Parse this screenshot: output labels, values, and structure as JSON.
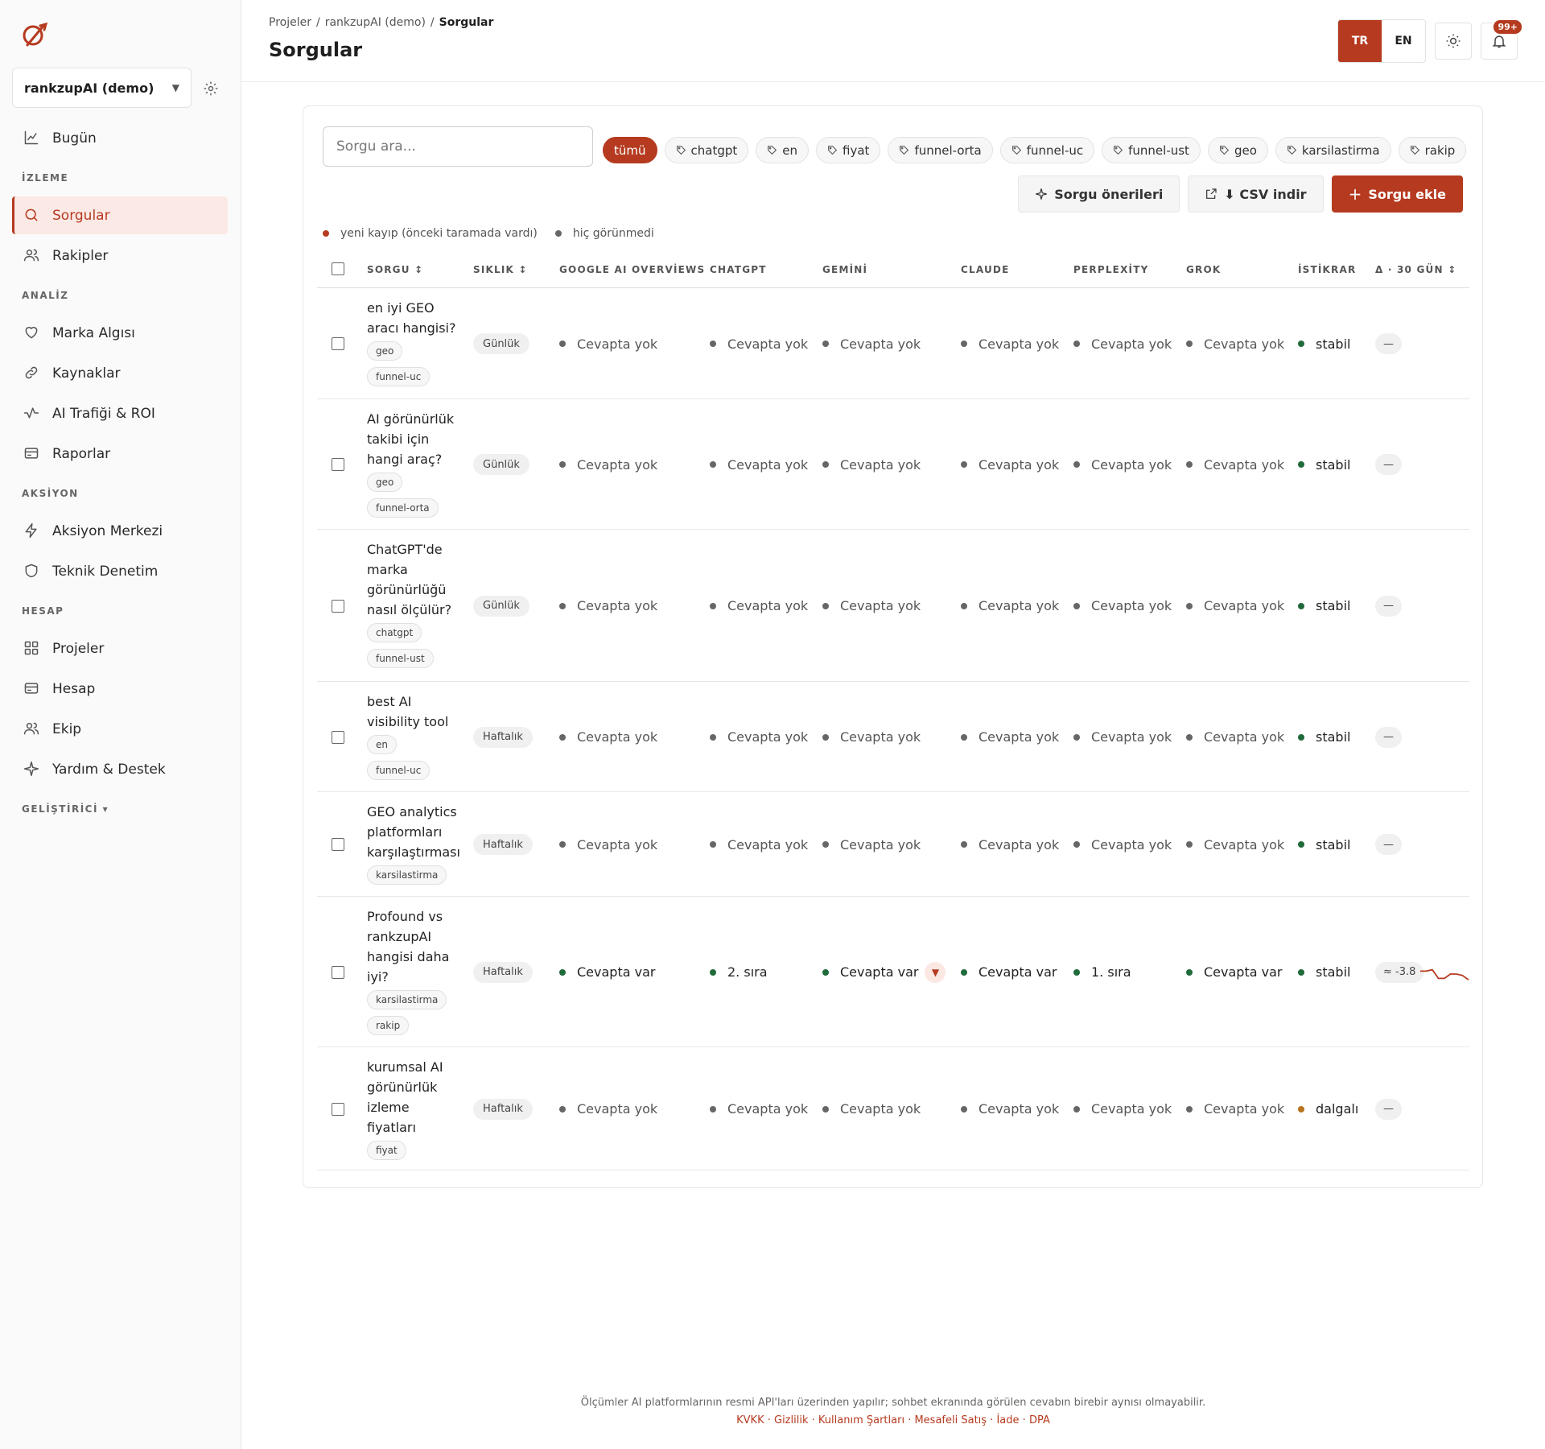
{
  "sidebar": {
    "project": "rankzupAI (demo)",
    "items": [
      {
        "type": "item",
        "label": "Bugün",
        "icon": "chart-icon",
        "active": false
      },
      {
        "type": "section",
        "label": "İZLEME"
      },
      {
        "type": "item",
        "label": "Sorgular",
        "icon": "search-icon",
        "active": true
      },
      {
        "type": "item",
        "label": "Rakipler",
        "icon": "users-icon",
        "active": false
      },
      {
        "type": "section",
        "label": "ANALİZ"
      },
      {
        "type": "item",
        "label": "Marka Algısı",
        "icon": "heart-icon",
        "active": false
      },
      {
        "type": "item",
        "label": "Kaynaklar",
        "icon": "link-icon",
        "active": false
      },
      {
        "type": "item",
        "label": "AI Trafiği & ROI",
        "icon": "activity-icon",
        "active": false
      },
      {
        "type": "item",
        "label": "Raporlar",
        "icon": "card-icon",
        "active": false
      },
      {
        "type": "section",
        "label": "AKSİYON"
      },
      {
        "type": "item",
        "label": "Aksiyon Merkezi",
        "icon": "bolt-icon",
        "active": false
      },
      {
        "type": "item",
        "label": "Teknik Denetim",
        "icon": "shield-icon",
        "active": false
      },
      {
        "type": "section",
        "label": "HESAP"
      },
      {
        "type": "item",
        "label": "Projeler",
        "icon": "grid-icon",
        "active": false
      },
      {
        "type": "item",
        "label": "Hesap",
        "icon": "card-icon",
        "active": false
      },
      {
        "type": "item",
        "label": "Ekip",
        "icon": "users-icon",
        "active": false
      },
      {
        "type": "item",
        "label": "Yardım & Destek",
        "icon": "sparkle-icon",
        "active": false
      },
      {
        "type": "section",
        "label": "GELİŞTİRİCİ ▾"
      }
    ]
  },
  "header": {
    "breadcrumb": [
      "Projeler",
      "rankzupAI (demo)",
      "Sorgular"
    ],
    "title": "Sorgular",
    "lang_tr": "TR",
    "lang_en": "EN",
    "notif_badge": "99+"
  },
  "toolbar": {
    "search_placeholder": "Sorgu ara...",
    "chips": [
      {
        "label": "tümü",
        "active": true,
        "tag": false
      },
      {
        "label": "chatgpt",
        "active": false,
        "tag": true
      },
      {
        "label": "en",
        "active": false,
        "tag": true
      },
      {
        "label": "fiyat",
        "active": false,
        "tag": true
      },
      {
        "label": "funnel-orta",
        "active": false,
        "tag": true
      },
      {
        "label": "funnel-uc",
        "active": false,
        "tag": true
      },
      {
        "label": "funnel-ust",
        "active": false,
        "tag": true
      },
      {
        "label": "geo",
        "active": false,
        "tag": true
      },
      {
        "label": "karsilastirma",
        "active": false,
        "tag": true
      },
      {
        "label": "rakip",
        "active": false,
        "tag": true
      }
    ],
    "suggest_label": "Sorgu önerileri",
    "csv_label": "⬇ CSV indir",
    "add_label": "Sorgu ekle"
  },
  "legend": {
    "lost": "yeni kayıp (önceki taramada vardı)",
    "never": "hiç görünmedi"
  },
  "colors": {
    "accent": "#b53a1f",
    "positive": "#1f6b3a",
    "wavy": "#b8731f",
    "neutral": "#666666"
  },
  "table": {
    "headers": {
      "query": "SORGU ↕",
      "freq": "SIKLIK ↕",
      "google": "GOOGLE AI OVERVİEWS",
      "chatgpt": "CHATGPT",
      "gemini": "GEMİNİ",
      "claude": "CLAUDE",
      "perplexity": "PERPLEXİTY",
      "grok": "GROK",
      "stability": "İSTİKRAR",
      "delta": "Δ · 30 GÜN ↕"
    },
    "rows": [
      {
        "lines": [
          "en iyi GEO",
          "aracı hangisi?"
        ],
        "tags": [
          "geo",
          "funnel-uc"
        ],
        "freq": "Günlük",
        "cells": [
          "Cevapta yok",
          "Cevapta yok",
          "Cevapta yok",
          "Cevapta yok",
          "Cevapta yok",
          "Cevapta yok"
        ],
        "stability": "stabil",
        "delta": "—"
      },
      {
        "lines": [
          "AI görünürlük",
          "takibi için",
          "hangi araç?"
        ],
        "tags": [
          "geo",
          "funnel-orta"
        ],
        "freq": "Günlük",
        "cells": [
          "Cevapta yok",
          "Cevapta yok",
          "Cevapta yok",
          "Cevapta yok",
          "Cevapta yok",
          "Cevapta yok"
        ],
        "stability": "stabil",
        "delta": "—"
      },
      {
        "lines": [
          "ChatGPT'de",
          "marka",
          "görünürlüğü",
          "nasıl ölçülür?"
        ],
        "tags": [
          "chatgpt",
          "funnel-ust"
        ],
        "freq": "Günlük",
        "cells": [
          "Cevapta yok",
          "Cevapta yok",
          "Cevapta yok",
          "Cevapta yok",
          "Cevapta yok",
          "Cevapta yok"
        ],
        "stability": "stabil",
        "delta": "—"
      },
      {
        "lines": [
          "best AI",
          "visibility tool"
        ],
        "tags": [
          "en",
          "funnel-uc"
        ],
        "freq": "Haftalık",
        "cells": [
          "Cevapta yok",
          "Cevapta yok",
          "Cevapta yok",
          "Cevapta yok",
          "Cevapta yok",
          "Cevapta yok"
        ],
        "stability": "stabil",
        "delta": "—"
      },
      {
        "lines": [
          "GEO analytics",
          "platformları",
          "karşılaştırması"
        ],
        "tags": [
          "karsilastirma"
        ],
        "freq": "Haftalık",
        "cells": [
          "Cevapta yok",
          "Cevapta yok",
          "Cevapta yok",
          "Cevapta yok",
          "Cevapta yok",
          "Cevapta yok"
        ],
        "stability": "stabil",
        "delta": "—"
      },
      {
        "lines": [
          "Profound vs",
          "rankzupAI",
          "hangisi daha",
          "iyi?"
        ],
        "tags": [
          "karsilastirma",
          "rakip"
        ],
        "freq": "Haftalık",
        "cells": [
          "Cevapta var",
          "2. sıra",
          "Cevapta var",
          "Cevapta var",
          "1. sıra",
          "Cevapta var"
        ],
        "stability": "stabil",
        "delta": "≈ -3.8",
        "trend": [
          0.3,
          0.3,
          0.2,
          0.8,
          0.8,
          0.5,
          0.5,
          0.6,
          0.9
        ]
      },
      {
        "lines": [
          "kurumsal AI",
          "görünürlük",
          "izleme",
          "fiyatları"
        ],
        "tags": [
          "fiyat"
        ],
        "freq": "Haftalık",
        "cells": [
          "Cevapta yok",
          "Cevapta yok",
          "Cevapta yok",
          "Cevapta yok",
          "Cevapta yok",
          "Cevapta yok"
        ],
        "stability": "dalgalı",
        "delta": "—"
      }
    ]
  },
  "footer": {
    "note": "Ölçümler AI platformlarının resmi API'ları üzerinden yapılır; sohbet ekranında görülen cevabın birebir aynısı olmayabilir.",
    "links": [
      "KVKK",
      "Gizlilik",
      "Kullanım Şartları",
      "Mesafeli Satış",
      "İade",
      "DPA"
    ]
  }
}
